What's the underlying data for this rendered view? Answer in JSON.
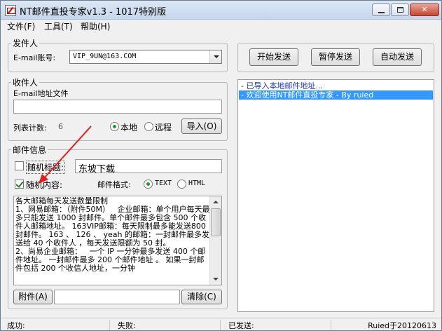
{
  "window": {
    "title": "NT邮件直投专家v1.3 - 1017特别版",
    "minimize_label": "",
    "maximize_label": "",
    "close_label": "✕"
  },
  "menu": {
    "file": "文件(F)",
    "tools": "工具(T)",
    "help": "帮助(H)"
  },
  "sender": {
    "group_title": "发件人",
    "account_label": "E-mail账号:",
    "account_value": "VIP_9UN@163.COM"
  },
  "recipient": {
    "group_title": "收件人",
    "file_label": "E-mail地址文件",
    "file_value": "",
    "count_label": "列表计数:",
    "count_value": "6",
    "local_label": "本地",
    "remote_label": "远程",
    "import_button": "导入(O)"
  },
  "mail": {
    "group_title": "邮件信息",
    "random_title_label": "随机标题:",
    "subject_value": "东坡下载",
    "random_content_label": "随机内容:",
    "format_label": "邮件格式:",
    "format_text": "TEXT",
    "format_html": "HTML",
    "content": "各大邮箱每天发送数量限制\n1、网易邮箱：（附件50M）   企业邮箱：单个用户每天最多只能发送 1000 封邮件。单个邮件最多包含 500 个收件人邮箱地址。 163VIP邮箱：每天限制最多能发送800封邮件。 163 、 126 、 yeah 的邮箱：一封邮件最多发送给 40 个收件人 ，每天发送限额为 50 封。\n2、尚易企业邮箱：   一个 IP 一分钟最多发送 400 个邮件地址。 一封邮件最多 200 个邮件地址 。 如果一封邮件包括 200 个收信人地址，一分钟",
    "attach_button": "附件(A)",
    "clear_button": "清除(C)"
  },
  "actions": {
    "start": "开始发送",
    "pause": "暂停发送",
    "auto": "自动发送"
  },
  "log": [
    "- 已导入本地邮件地址...",
    "- 欢迎使用NT邮件直投专家 - By ruied"
  ],
  "status": {
    "success": "成功:",
    "fail": "失败:",
    "sent": "已发送:",
    "credit": "Ruied于20120613"
  }
}
